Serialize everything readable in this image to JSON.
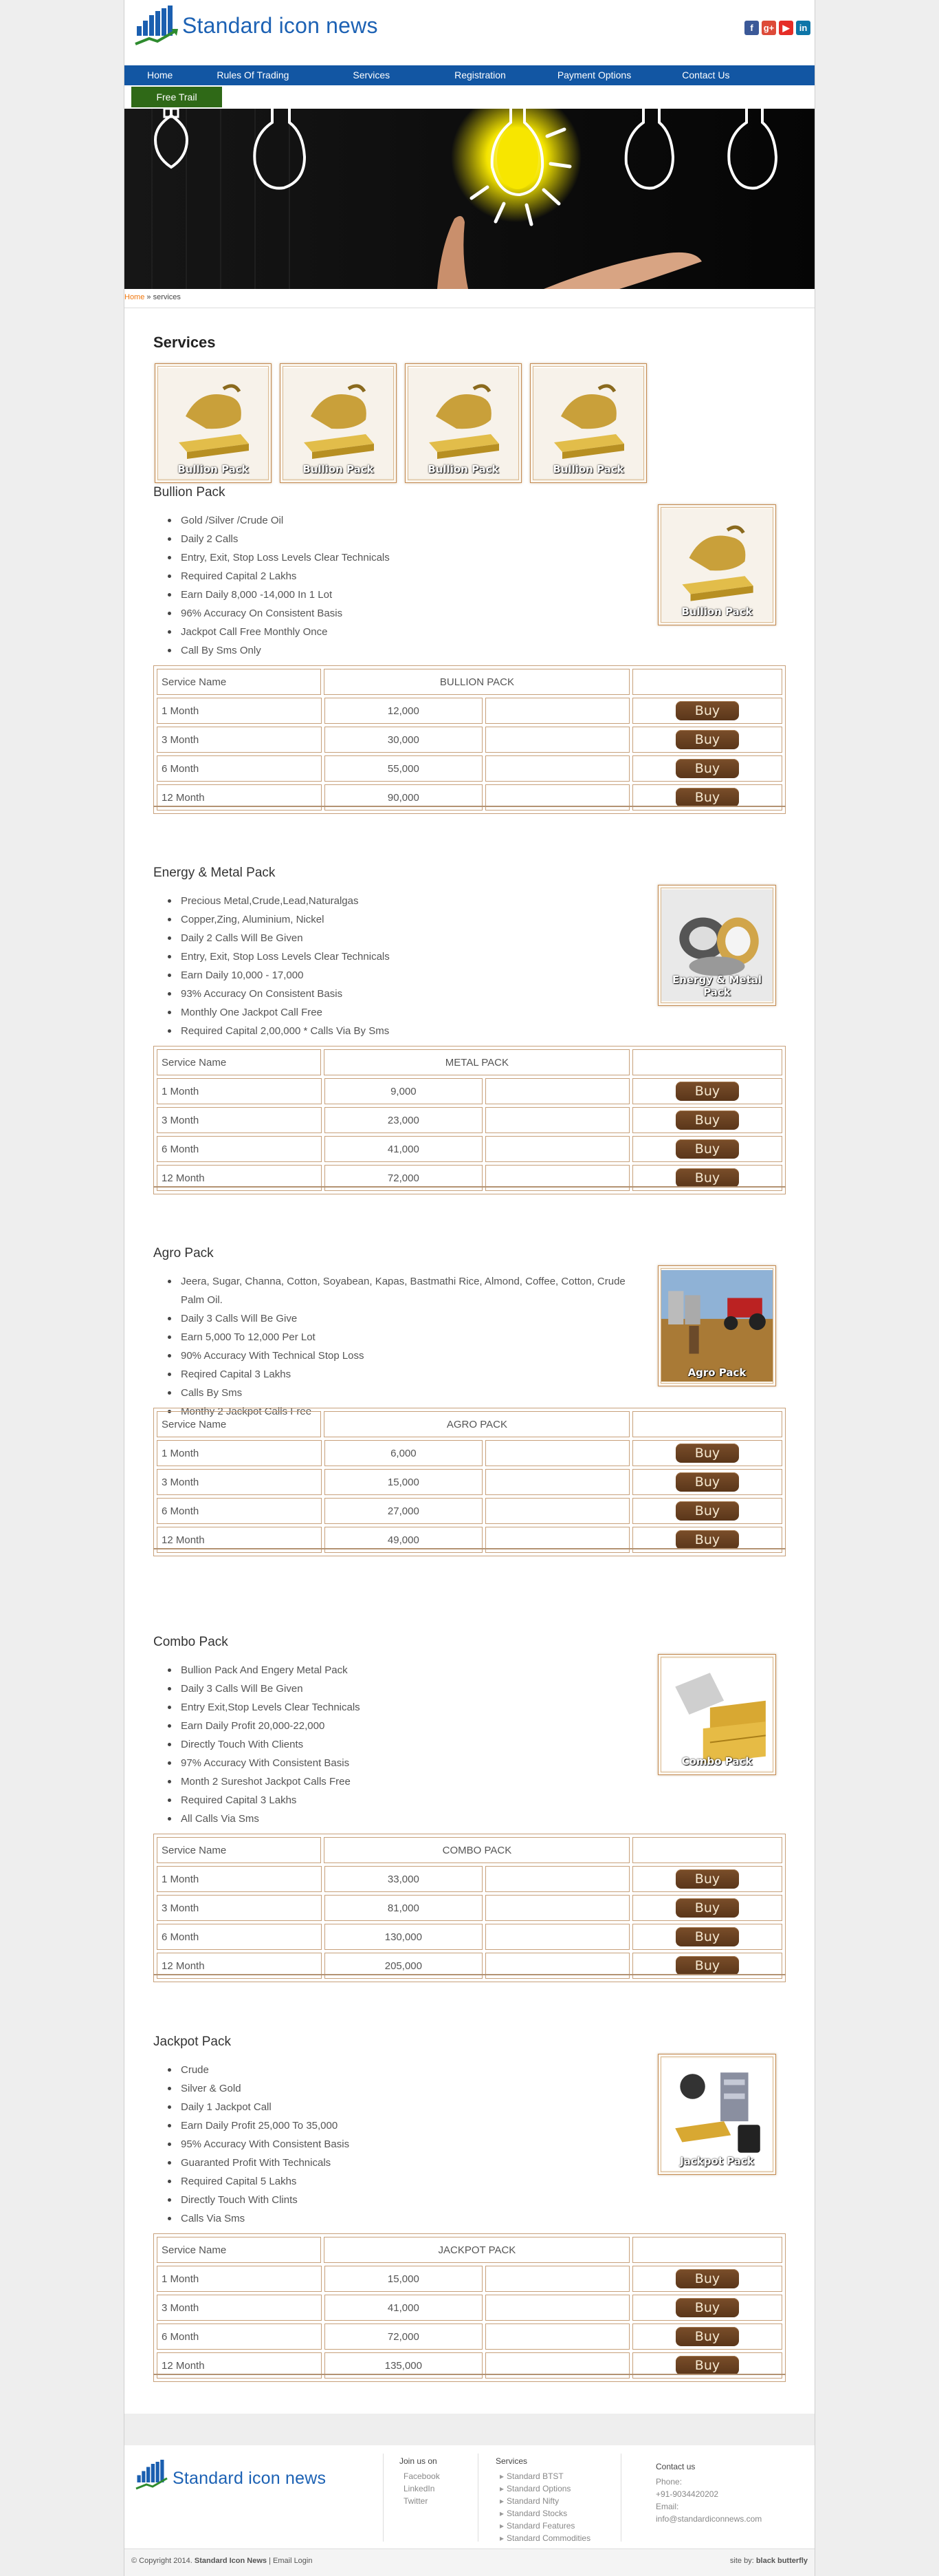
{
  "brand": {
    "name": "Standard icon news"
  },
  "social": [
    {
      "icon": "facebook-icon",
      "glyph": "f",
      "color": "#3b5998"
    },
    {
      "icon": "google-plus-icon",
      "glyph": "g+",
      "color": "#dd4b39"
    },
    {
      "icon": "youtube-icon",
      "glyph": "▶",
      "color": "#e52d27"
    },
    {
      "icon": "linkedin-icon",
      "glyph": "in",
      "color": "#0e76a8"
    }
  ],
  "nav": [
    "Home",
    "Rules Of Trading",
    "Services",
    "Registration",
    "Payment Options",
    "Contact Us"
  ],
  "free_trail": "Free Trail",
  "breadcrumb": {
    "home": "Home",
    "sep": " » ",
    "current": "services"
  },
  "page_title": "Services",
  "thumb_label": "Bullion Pack",
  "buy_label": "Buy",
  "packs": [
    {
      "title": "Bullion Pack",
      "image_label": "Bullion Pack",
      "features": [
        "Gold /Silver /Crude Oil",
        "Daily 2 Calls",
        "Entry, Exit, Stop Loss Levels Clear Technicals",
        "Required Capital 2 Lakhs",
        "Earn Daily 8,000 -14,000 In 1 Lot",
        "96% Accuracy On Consistent Basis",
        "Jackpot Call Free Monthly Once",
        "Call By Sms Only"
      ],
      "table_header": {
        "service_name": "Service Name",
        "pack_name": "BULLION PACK"
      },
      "rows": [
        {
          "period": "1 Month",
          "price": "12,000"
        },
        {
          "period": "3 Month",
          "price": "30,000"
        },
        {
          "period": "6 Month",
          "price": "55,000"
        },
        {
          "period": "12 Month",
          "price": "90,000"
        }
      ]
    },
    {
      "title": "Energy & Metal Pack",
      "image_label": "Energy & Metal Pack",
      "features": [
        "Precious Metal,Crude,Lead,Naturalgas",
        "Copper,Zing, Aluminium, Nickel",
        "Daily 2 Calls Will Be Given",
        "Entry, Exit, Stop Loss Levels Clear Technicals",
        "Earn Daily 10,000 - 17,000",
        "93% Accuracy On Consistent Basis",
        "Monthly One Jackpot Call Free",
        "Required Capital 2,00,000 * Calls Via By Sms"
      ],
      "table_header": {
        "service_name": "Service Name",
        "pack_name": "METAL PACK"
      },
      "rows": [
        {
          "period": "1 Month",
          "price": "9,000"
        },
        {
          "period": "3 Month",
          "price": "23,000"
        },
        {
          "period": "6 Month",
          "price": "41,000"
        },
        {
          "period": "12 Month",
          "price": "72,000"
        }
      ]
    },
    {
      "title": "Agro Pack",
      "image_label": "Agro Pack",
      "features": [
        "Jeera, Sugar, Channa, Cotton, Soyabean, Kapas, Bastmathi Rice, Almond, Coffee, Cotton, Crude Palm Oil.",
        "Daily 3 Calls Will Be Give",
        "Earn 5,000 To 12,000 Per Lot",
        "90% Accuracy With Technical Stop Loss",
        "Reqired Capital 3 Lakhs",
        "Calls By Sms",
        "Monthy 2 Jackpot Calls Free"
      ],
      "table_header": {
        "service_name": "Service Name",
        "pack_name": "AGRO PACK"
      },
      "rows": [
        {
          "period": "1 Month",
          "price": "6,000"
        },
        {
          "period": "3 Month",
          "price": "15,000"
        },
        {
          "period": "6 Month",
          "price": "27,000"
        },
        {
          "period": "12 Month",
          "price": "49,000"
        }
      ]
    },
    {
      "title": "Combo Pack",
      "image_label": "Combo Pack",
      "features": [
        "Bullion Pack And Engery Metal Pack",
        "Daily 3 Calls Will Be Given",
        "Entry Exit,Stop Levels Clear Technicals",
        "Earn Daily Profit 20,000-22,000",
        "Directly Touch With Clients",
        "97% Accuracy With Consistent Basis",
        "Month 2 Sureshot Jackpot Calls Free",
        "Required Capital 3 Lakhs",
        "All Calls Via Sms"
      ],
      "table_header": {
        "service_name": "Service Name",
        "pack_name": "COMBO PACK"
      },
      "rows": [
        {
          "period": "1 Month",
          "price": "33,000"
        },
        {
          "period": "3 Month",
          "price": "81,000"
        },
        {
          "period": "6 Month",
          "price": "130,000"
        },
        {
          "period": "12 Month",
          "price": "205,000"
        }
      ]
    },
    {
      "title": "Jackpot Pack",
      "image_label": "Jackpot Pack",
      "features": [
        "Crude",
        "Silver & Gold",
        "Daily 1 Jackpot Call",
        "Earn Daily Profit 25,000 To 35,000",
        "95% Accuracy With Consistent Basis",
        "Guaranted Profit With Technicals",
        "Required Capital 5 Lakhs",
        "Directly Touch With Clints",
        "Calls Via Sms"
      ],
      "table_header": {
        "service_name": "Service Name",
        "pack_name": "JACKPOT PACK"
      },
      "rows": [
        {
          "period": "1 Month",
          "price": "15,000"
        },
        {
          "period": "3 Month",
          "price": "41,000"
        },
        {
          "period": "6 Month",
          "price": "72,000"
        },
        {
          "period": "12 Month",
          "price": "135,000"
        }
      ]
    }
  ],
  "footer": {
    "join_heading": "Join us on",
    "join_links": [
      "Facebook",
      "LinkedIn",
      "Twitter"
    ],
    "services_heading": "Services",
    "services_links": [
      "Standard BTST",
      "Standard Options",
      "Standard Nifty",
      "Standard Stocks",
      "Standard Features",
      "Standard Commodities"
    ],
    "contact_heading": "Contact us",
    "phone_label": "Phone:",
    "phone": "+91-9034420202",
    "email_label": "Email:",
    "email": "info@standardiconnews.com"
  },
  "copyright": {
    "prefix": "© Copyright 2014.",
    "brand": "Standard Icon News",
    "links": "| Email Login"
  },
  "credit": {
    "prefix": "site by:",
    "name": "black butterfly"
  }
}
